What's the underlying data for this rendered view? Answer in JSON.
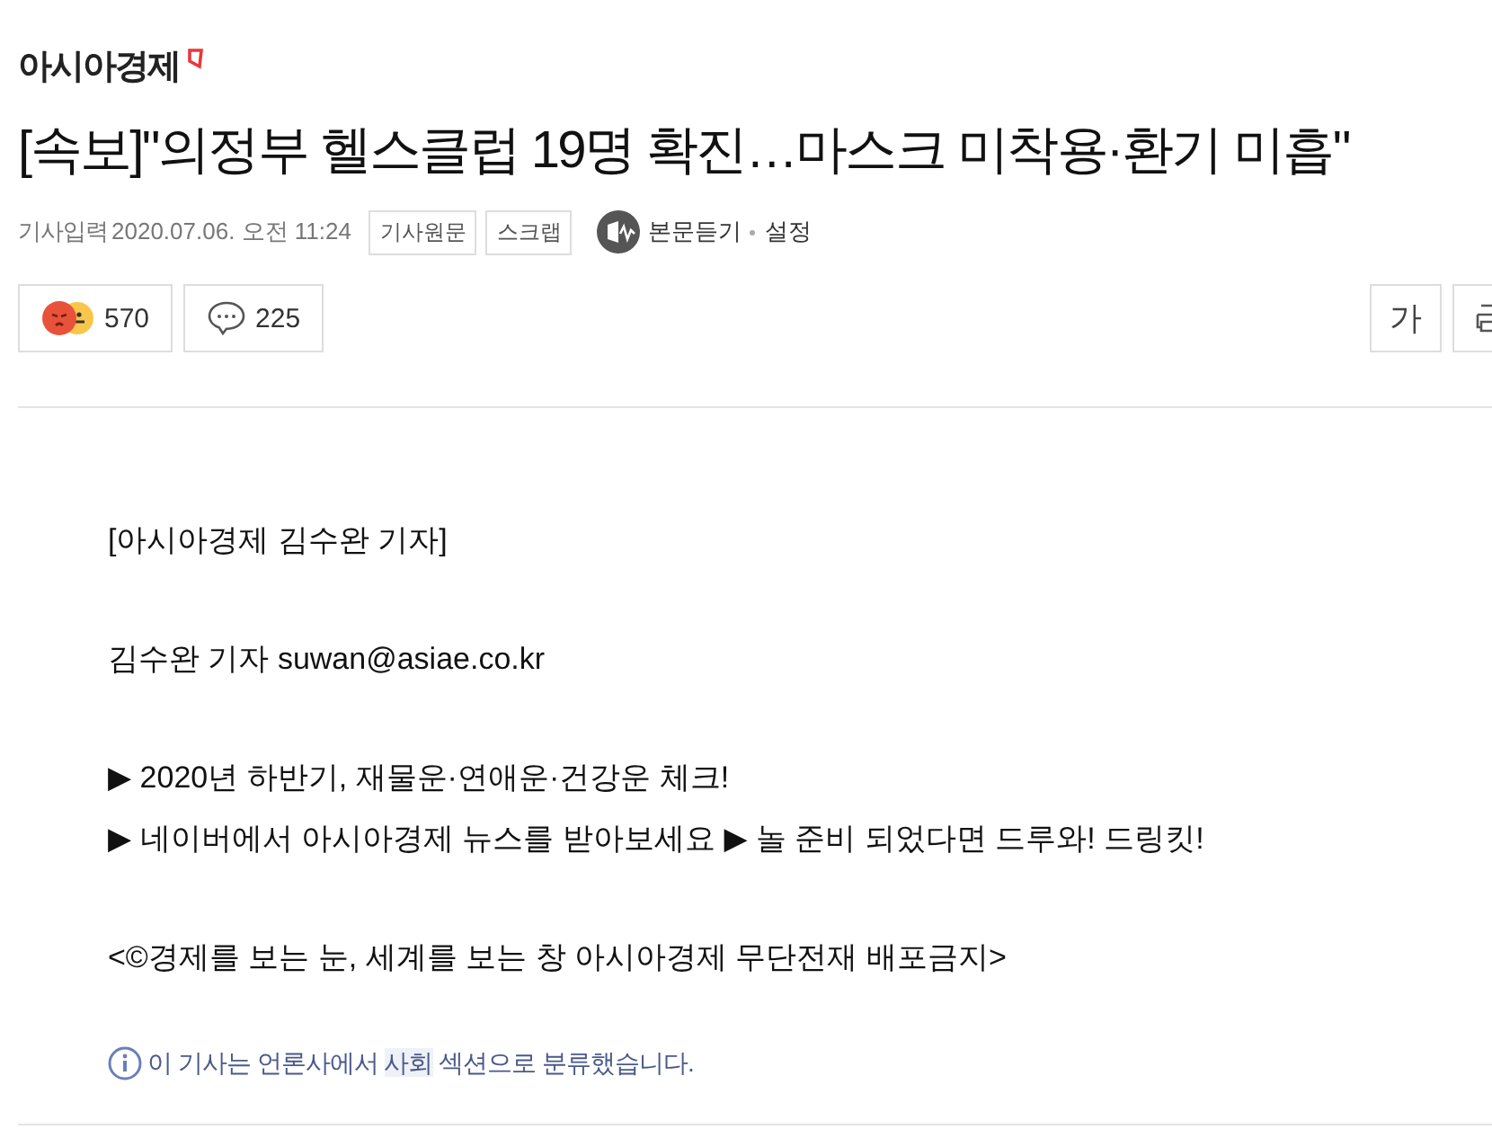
{
  "press": {
    "name": "아시아경제"
  },
  "article": {
    "title": "[속보]\"의정부 헬스클럽 19명 확진…마스크 미착용·환기 미흡\"",
    "date_label": "기사입력",
    "date": "2020.07.06. 오전 11:24",
    "meta_buttons": [
      "기사원문",
      "스크랩"
    ],
    "listen": "본문듣기",
    "settings": "설정"
  },
  "toolbar": {
    "reactions": "570",
    "comments": "225",
    "font_button": "가"
  },
  "body": [
    "[아시아경제 김수완 기자]",
    "김수완 기자 suwan@asiae.co.kr",
    "▶ 2020년 하반기, 재물운·연애운·건강운 체크!\n▶ 네이버에서 아시아경제 뉴스를 받아보세요 ▶ 놀 준비 되었다면 드루와! 드링킷!",
    "<©경제를 보는 눈, 세계를 보는 창 아시아경제 무단전재 배포금지>"
  ],
  "notice": {
    "before": "이 기사는 언론사에서 ",
    "section": "사회",
    "after": " 섹션으로 분류했습니다."
  }
}
